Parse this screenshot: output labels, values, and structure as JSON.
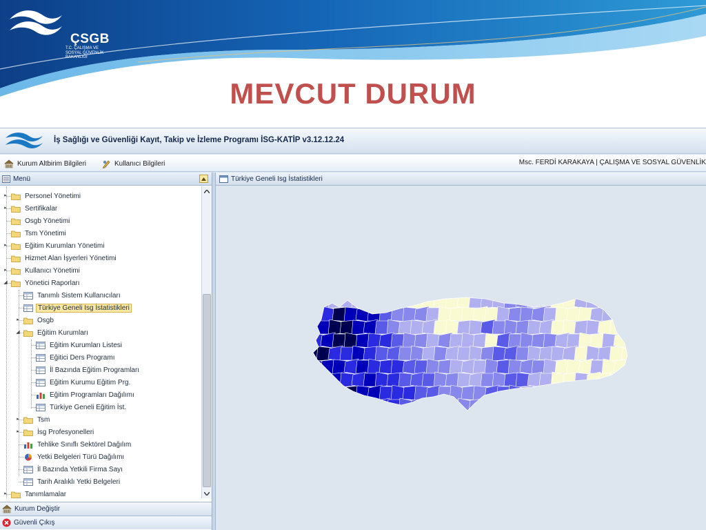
{
  "slide": {
    "title": "MEVCUT DURUM",
    "logo": {
      "name": "ÇSGB",
      "subtitle_lines": [
        "T.C. ÇALIŞMA VE",
        "SOSYAL GÜVENLİK",
        "BAKANLIĞI"
      ]
    }
  },
  "app": {
    "title": "İş Sağlığı ve Güvenliği Kayıt, Takip ve İzleme Programı İSG-KATİP v3.12.12.24",
    "toolbar": {
      "kurum_label": "Kurum Altbirim Bilgileri",
      "kullanici_label": "Kullanıcı Bilgileri",
      "user_info": "Msc. FERDİ KARAKAYA | ÇALIŞMA VE SOSYAL GÜVENLİK"
    },
    "menu": {
      "title": "Menü",
      "items": [
        {
          "label": "Personel Yönetimi",
          "icon": "folder-icon"
        },
        {
          "label": "Sertifikalar",
          "icon": "folder-icon"
        },
        {
          "label": "Osgb Yönetimi",
          "icon": "folder-icon"
        },
        {
          "label": "Tsm Yönetimi",
          "icon": "folder-icon"
        },
        {
          "label": "Eğitim Kurumları Yönetimi",
          "icon": "folder-icon"
        },
        {
          "label": "Hizmet Alan İşyerleri Yönetimi",
          "icon": "folder-icon"
        },
        {
          "label": "Kullanıcı Yönetimi",
          "icon": "folder-icon"
        },
        {
          "label": "Yönetici Raporları",
          "icon": "folder-icon"
        },
        {
          "label": "Tanımlı Sistem Kullanıcıları",
          "icon": "table-icon"
        },
        {
          "label": "Türkiye Geneli Isg İstatistikleri",
          "icon": "table-icon"
        },
        {
          "label": "Osgb",
          "icon": "folder-icon"
        },
        {
          "label": "Eğitim Kurumları",
          "icon": "folder-icon"
        },
        {
          "label": "Eğitim Kurumları Listesi",
          "icon": "table-icon"
        },
        {
          "label": "Eğitici Ders Programı",
          "icon": "table-icon"
        },
        {
          "label": "İl Bazında Eğitim Programları",
          "icon": "table-icon"
        },
        {
          "label": "Eğitim Kurumu Eğitim Prg.",
          "icon": "table-icon"
        },
        {
          "label": "Eğitim Programları Dağılımı",
          "icon": "bar-chart-icon"
        },
        {
          "label": "Türkiye Geneli Eğitim İst.",
          "icon": "table-icon"
        },
        {
          "label": "Tsm",
          "icon": "folder-icon"
        },
        {
          "label": "İsg Profesyonelleri",
          "icon": "folder-icon"
        },
        {
          "label": "Tehlike Sınıflı Sektörel Dağılım",
          "icon": "bar-chart-icon"
        },
        {
          "label": "Yetki Belgeleri Türü Dağılımı",
          "icon": "pie-chart-icon"
        },
        {
          "label": "İl Bazında Yetkili Firma Sayı",
          "icon": "table-icon"
        },
        {
          "label": "Tarih Aralıklı Yetki Belgeleri",
          "icon": "table-icon"
        },
        {
          "label": "Tanımlamalar",
          "icon": "folder-icon"
        }
      ]
    },
    "bottom": {
      "kurum_degistir": "Kurum Değiştir",
      "guvenli_cikis": "Güvenli Çıkış"
    },
    "tab": {
      "title": "Türkiye Geneli Isg İstatistikleri"
    },
    "map": {
      "palette": [
        "#000050",
        "#0000b8",
        "#2a2ae0",
        "#5a5ae8",
        "#8888ec",
        "#b0b0f0",
        "#fafad2"
      ]
    }
  }
}
